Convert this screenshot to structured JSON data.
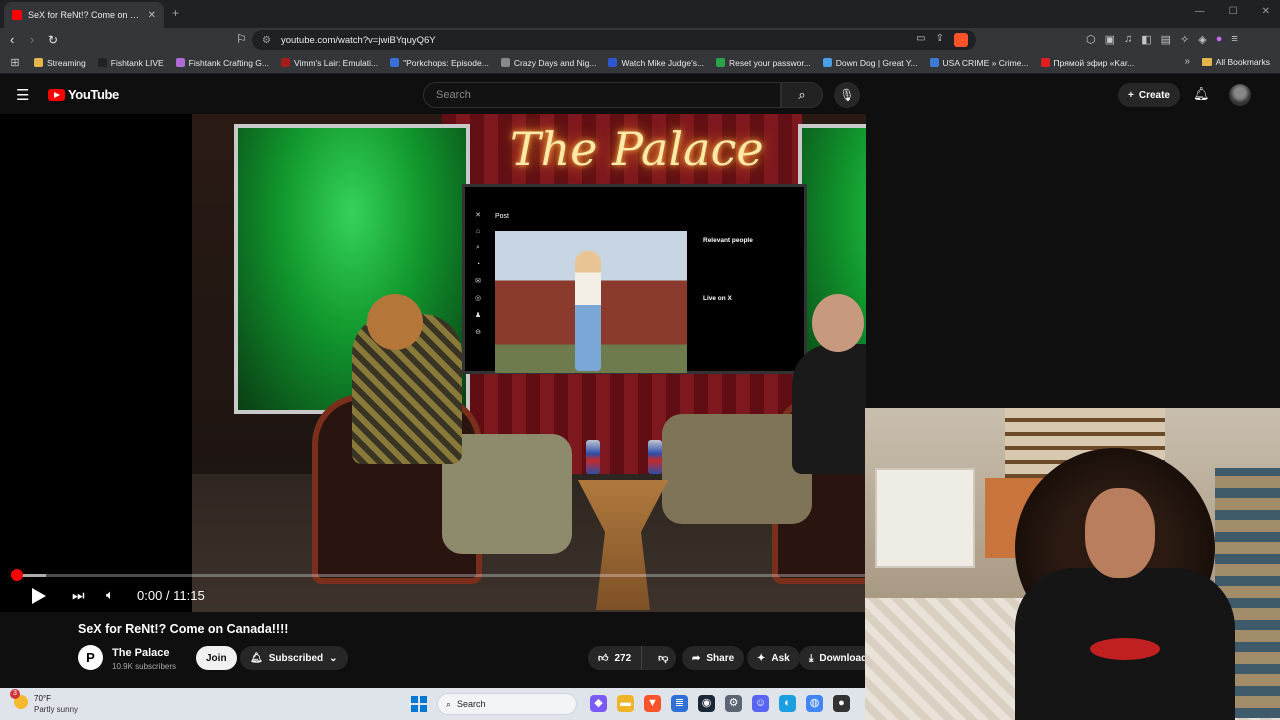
{
  "browser": {
    "tab_title": "SeX for ReNt!? Come on Canada!!!! - YouTube",
    "tab_close": "✕",
    "new_tab": "+",
    "url": "youtube.com/watch?v=jwiBYquyQ6Y",
    "bookmarks": [
      {
        "label": "Streaming",
        "color": "#e4b54a"
      },
      {
        "label": "Fishtank LIVE",
        "color": "#222222"
      },
      {
        "label": "Fishtank Crafting G...",
        "color": "#b16bd6"
      },
      {
        "label": "Vimm's Lair: Emulati...",
        "color": "#a31d1d"
      },
      {
        "label": "\"Porkchops: Episode...",
        "color": "#3a6fd8"
      },
      {
        "label": "Crazy Days and Nig...",
        "color": "#888888"
      },
      {
        "label": "Watch Mike Judge's...",
        "color": "#2d56d1"
      },
      {
        "label": "Reset your passwor...",
        "color": "#2aa34a"
      },
      {
        "label": "Down Dog | Great Y...",
        "color": "#4aa0e6"
      },
      {
        "label": "USA CRIME » Crime...",
        "color": "#3b7bd6"
      },
      {
        "label": "Прямой эфир «Kar...",
        "color": "#e01f1f"
      }
    ],
    "bookmarks_more": "»",
    "all_bookmarks": "All Bookmarks"
  },
  "youtube": {
    "logo_text": "YouTube",
    "search_placeholder": "Search",
    "create_label": "Create",
    "player": {
      "time_current": "0:00",
      "time_separator": " / ",
      "time_total": "11:15",
      "progress_fraction": 0.0,
      "scene_sign": "The Palace",
      "screen_post_label": "Post",
      "screen_relevant": "Relevant people",
      "screen_live": "Live on X"
    },
    "video": {
      "title": "SeX for ReNt!? Come on Canada!!!!",
      "channel_name": "The Palace",
      "channel_initials": "P",
      "subscribers": "10.9K subscribers",
      "join_label": "Join",
      "subscribed_label": "Subscribed",
      "likes": "272",
      "share_label": "Share",
      "ask_label": "Ask",
      "download_label": "Download"
    }
  },
  "taskbar": {
    "weather_temp": "70°F",
    "weather_condition": "Partly sunny",
    "weather_badge": "3",
    "search_label": "Search",
    "accent": "#0078d4"
  }
}
